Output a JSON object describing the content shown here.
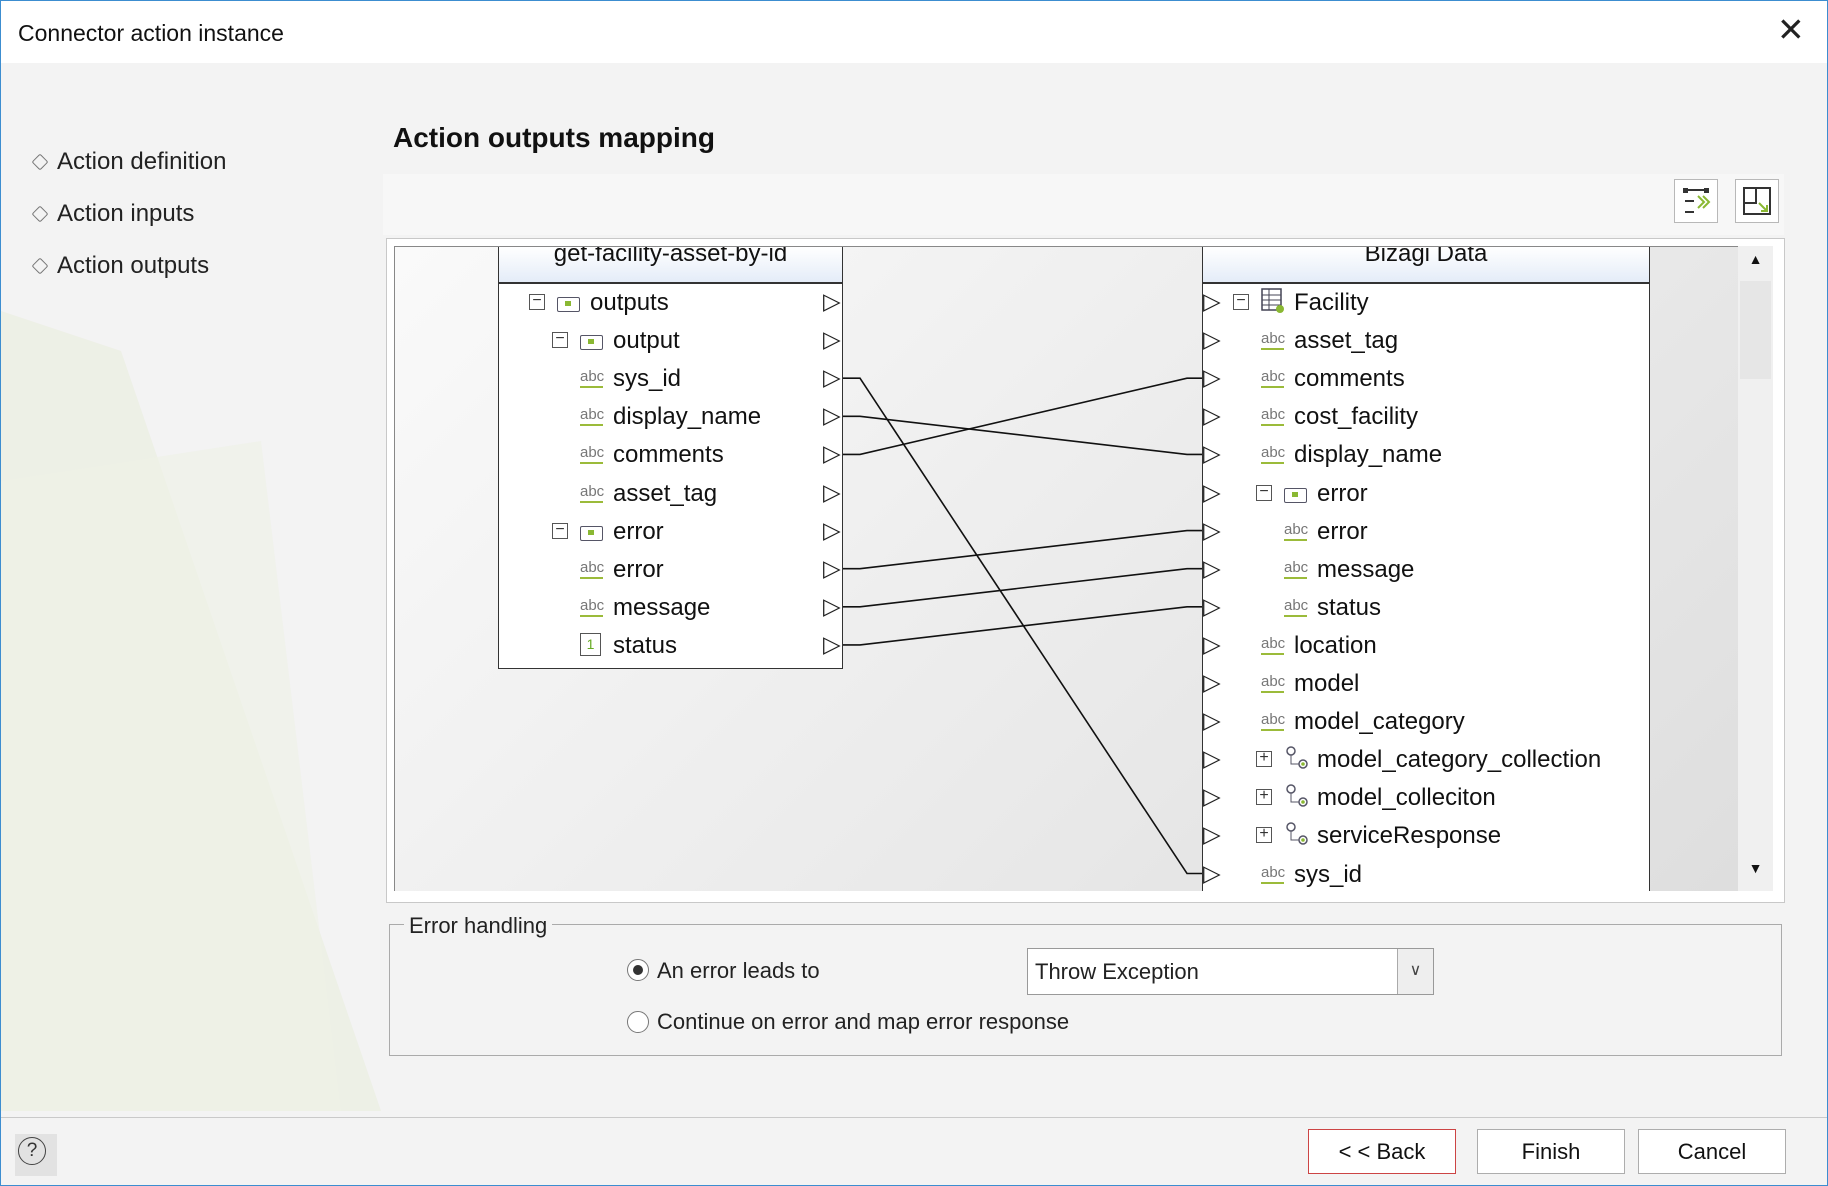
{
  "window": {
    "title": "Connector action instance",
    "close_icon": "close-icon"
  },
  "nav": [
    {
      "label": "Action definition"
    },
    {
      "label": "Action inputs"
    },
    {
      "label": "Action outputs"
    }
  ],
  "main": {
    "heading": "Action outputs mapping"
  },
  "toolbar": {
    "buttons": [
      {
        "icon": "auto-map-icon"
      },
      {
        "icon": "fit-view-icon"
      }
    ]
  },
  "mapping": {
    "left": {
      "title": "get-facility-asset-by-id",
      "rows": [
        {
          "label": "outputs",
          "type": "object",
          "depth": 0,
          "expanded": true
        },
        {
          "label": "output",
          "type": "object",
          "depth": 1,
          "expanded": true
        },
        {
          "label": "sys_id",
          "type": "string",
          "depth": 2
        },
        {
          "label": "display_name",
          "type": "string",
          "depth": 2
        },
        {
          "label": "comments",
          "type": "string",
          "depth": 2
        },
        {
          "label": "asset_tag",
          "type": "string",
          "depth": 2
        },
        {
          "label": "error",
          "type": "object",
          "depth": 1,
          "expanded": true
        },
        {
          "label": "error",
          "type": "string",
          "depth": 2
        },
        {
          "label": "message",
          "type": "string",
          "depth": 2
        },
        {
          "label": "status",
          "type": "number",
          "depth": 2,
          "type_badge": "1"
        }
      ]
    },
    "right": {
      "title": "Bizagi Data",
      "rows": [
        {
          "label": "Facility",
          "type": "entity",
          "depth": 0,
          "expanded": true
        },
        {
          "label": "asset_tag",
          "type": "string",
          "depth": 1
        },
        {
          "label": "comments",
          "type": "string",
          "depth": 1
        },
        {
          "label": "cost_facility",
          "type": "string",
          "depth": 1
        },
        {
          "label": "display_name",
          "type": "string",
          "depth": 1
        },
        {
          "label": "error",
          "type": "object",
          "depth": 1,
          "expanded": true
        },
        {
          "label": "error",
          "type": "string",
          "depth": 2
        },
        {
          "label": "message",
          "type": "string",
          "depth": 2
        },
        {
          "label": "status",
          "type": "string",
          "depth": 2
        },
        {
          "label": "location",
          "type": "string",
          "depth": 1
        },
        {
          "label": "model",
          "type": "string",
          "depth": 1
        },
        {
          "label": "model_category",
          "type": "string",
          "depth": 1
        },
        {
          "label": "model_category_collection",
          "type": "collection",
          "depth": 1,
          "expanded": false
        },
        {
          "label": "model_colleciton",
          "type": "collection",
          "depth": 1,
          "expanded": false
        },
        {
          "label": "serviceResponse",
          "type": "collection",
          "depth": 1,
          "expanded": false
        },
        {
          "label": "sys_id",
          "type": "string",
          "depth": 1
        }
      ]
    },
    "connections": [
      {
        "from": "output.sys_id",
        "to": "Facility.sys_id",
        "from_row": 2,
        "to_row": 15
      },
      {
        "from": "output.display_name",
        "to": "Facility.display_name",
        "from_row": 3,
        "to_row": 4
      },
      {
        "from": "output.comments",
        "to": "Facility.comments",
        "from_row": 4,
        "to_row": 2
      },
      {
        "from": "error.error",
        "to": "Facility.error.error",
        "from_row": 7,
        "to_row": 6
      },
      {
        "from": "error.message",
        "to": "Facility.error.message",
        "from_row": 8,
        "to_row": 7
      },
      {
        "from": "error.status",
        "to": "Facility.error.status",
        "from_row": 9,
        "to_row": 8
      }
    ]
  },
  "error_handling": {
    "legend": "Error handling",
    "option_error": "An error leads to",
    "option_continue": "Continue on error and map error response",
    "selected": "error",
    "dropdown_value": "Throw Exception"
  },
  "footer": {
    "help_icon": "help-icon",
    "back": "< < Back",
    "finish": "Finish",
    "cancel": "Cancel"
  }
}
